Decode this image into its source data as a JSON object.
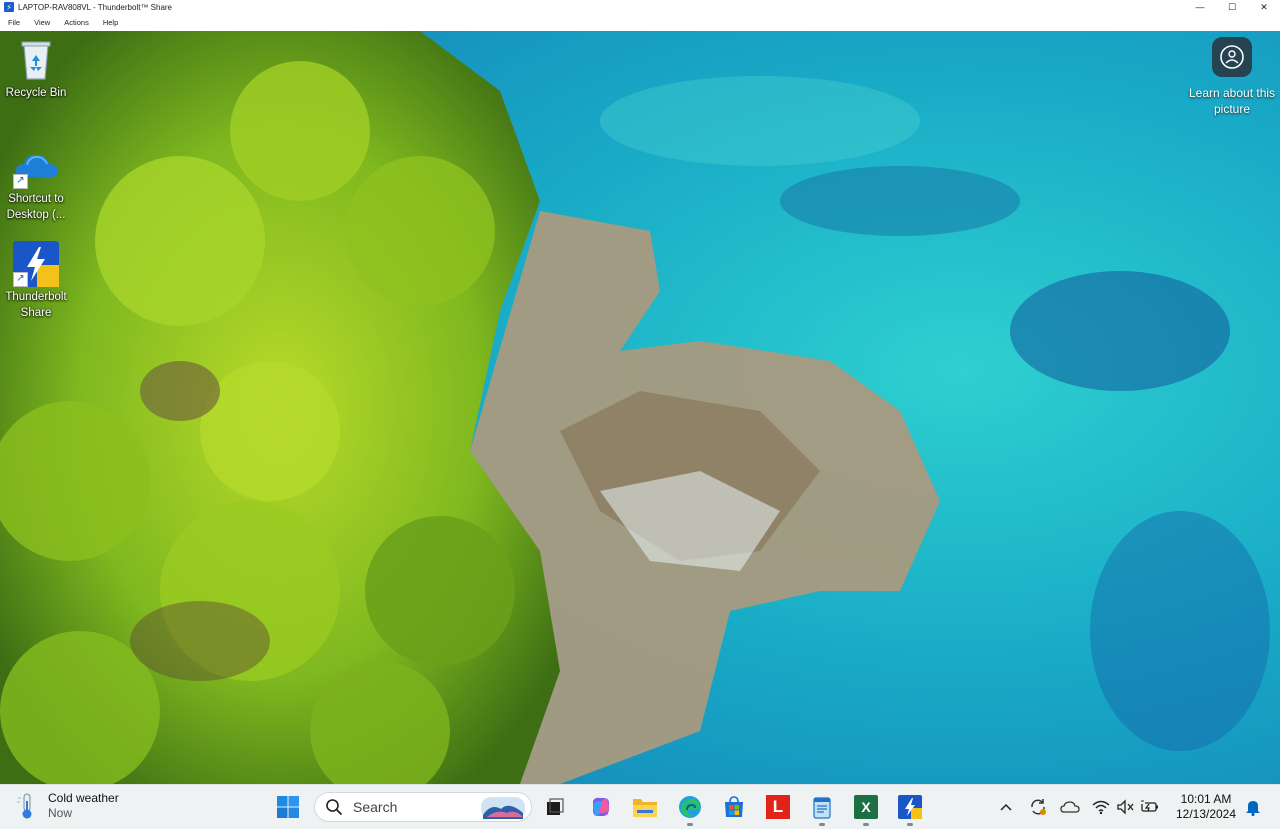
{
  "window": {
    "title": "LAPTOP-RAV808VL - Thunderbolt™ Share",
    "menu": [
      "File",
      "View",
      "Actions",
      "Help"
    ]
  },
  "desktop": {
    "icons": [
      {
        "label": "Recycle Bin",
        "icon": "recycle-bin-icon"
      },
      {
        "label": "Shortcut to Desktop (...",
        "icon": "onedrive-cloud-icon"
      },
      {
        "label": "Thunderbolt Share",
        "icon": "thunderbolt-share-icon"
      }
    ],
    "learn_about": "Learn about this picture"
  },
  "taskbar": {
    "weather": {
      "title": "Cold weather",
      "subtitle": "Now"
    },
    "search_placeholder": "Search",
    "excel_letter": "X",
    "lenovo_letter": "L",
    "clock": {
      "time": "10:01 AM",
      "date": "12/13/2024"
    }
  },
  "colors": {
    "taskbar_bg": "#eef2f3",
    "accent_blue": "#0067c0",
    "sea": "#1fb5c2",
    "forest": "#7fb81f"
  }
}
